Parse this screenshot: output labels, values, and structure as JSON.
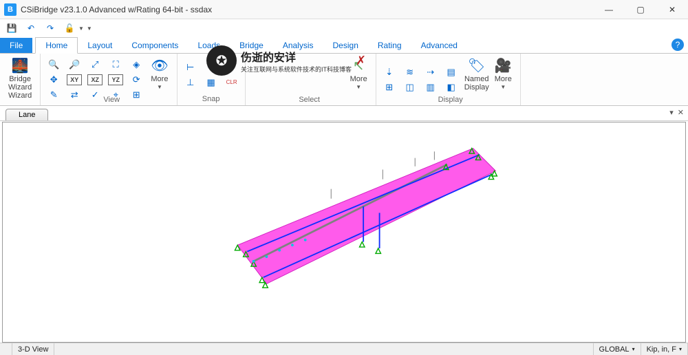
{
  "window": {
    "title": "CSiBridge v23.1.0 Advanced w/Rating 64-bit - ssdax",
    "app_icon_letter": "B"
  },
  "tabs": {
    "file": "File",
    "items": [
      "Home",
      "Layout",
      "Components",
      "Loads",
      "Bridge",
      "Analysis",
      "Design",
      "Rating",
      "Advanced"
    ],
    "active": "Home"
  },
  "ribbon": {
    "wizard": {
      "label": "Bridge\nWizard\nWizard"
    },
    "view": {
      "label": "View",
      "more": "More"
    },
    "snap": {
      "label": "Snap"
    },
    "select": {
      "label": "Select",
      "more": "More"
    },
    "display": {
      "label": "Display",
      "named": "Named\nDisplay",
      "more": "More"
    }
  },
  "watermark": {
    "line1": "伤逝的安详",
    "line2": "关注互联网与系统软件技术的IT科技博客"
  },
  "doctab": {
    "name": "Lane"
  },
  "status": {
    "view": "3-D View",
    "coord": "GLOBAL",
    "units": "Kip, in, F"
  }
}
